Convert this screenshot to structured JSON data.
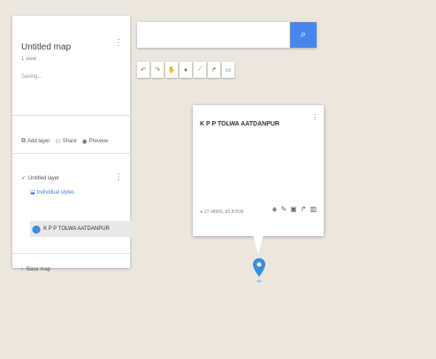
{
  "map": {
    "title": "Untitled map",
    "subtitle": "1 view",
    "status": "Saving...",
    "actions": [
      {
        "label": "Add layer",
        "icon": "add-layer-icon"
      },
      {
        "label": "Share",
        "icon": "share-icon"
      },
      {
        "label": "Preview",
        "icon": "preview-icon"
      }
    ]
  },
  "layer": {
    "name": "Untitled layer",
    "style_label": "Individual styles",
    "place": "K P P TOLWA AATDANPUR"
  },
  "basemap": {
    "label": "Base map"
  },
  "search": {
    "placeholder": "",
    "value": ""
  },
  "toolbar": {
    "tools": [
      "undo-icon",
      "redo-icon",
      "hand-icon",
      "marker-icon",
      "line-icon",
      "directions-icon",
      "ruler-icon"
    ]
  },
  "infowindow": {
    "title": "K P P TOLWA AATDANPUR",
    "coords": "27.48960, 80.87836",
    "tools": [
      "style-icon",
      "edit-icon",
      "camera-icon",
      "directions-icon",
      "delete-icon"
    ]
  },
  "colors": {
    "accent": "#4787ed",
    "marker": "#3a8edb",
    "map_background": "#ebe7df"
  }
}
